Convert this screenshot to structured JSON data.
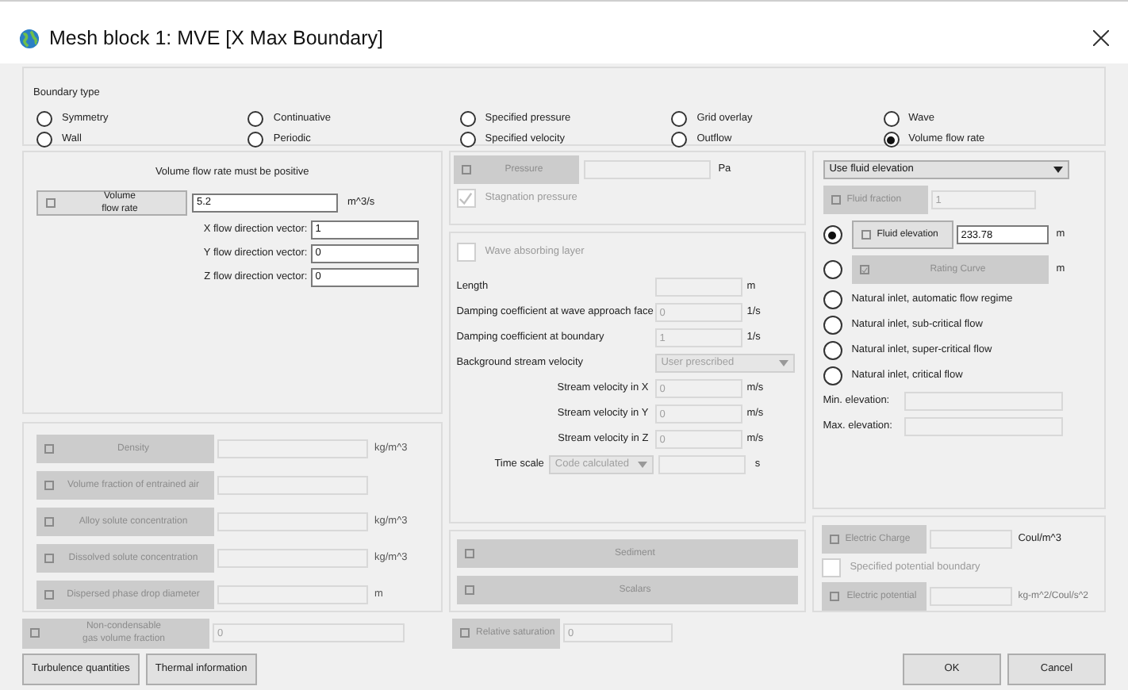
{
  "window": {
    "title": "Mesh block 1: MVE [X Max Boundary]"
  },
  "boundary_type": {
    "label": "Boundary type",
    "options": [
      {
        "label": "Symmetry",
        "selected": false
      },
      {
        "label": "Continuative",
        "selected": false
      },
      {
        "label": "Specified pressure",
        "selected": false
      },
      {
        "label": "Grid overlay",
        "selected": false
      },
      {
        "label": "Wave",
        "selected": false
      },
      {
        "label": "Wall",
        "selected": false
      },
      {
        "label": "Periodic",
        "selected": false
      },
      {
        "label": "Specified velocity",
        "selected": false
      },
      {
        "label": "Outflow",
        "selected": false
      },
      {
        "label": "Volume flow rate",
        "selected": true
      }
    ]
  },
  "flow_rate": {
    "message": "Volume flow rate must be positive",
    "toggle": {
      "label": "Volume\nflow rate",
      "checked": false,
      "disabled": false
    },
    "value": "5.2",
    "unit": "m^3/s",
    "vectors": [
      {
        "label": "X flow direction vector:",
        "value": "1"
      },
      {
        "label": "Y flow direction vector:",
        "value": "0"
      },
      {
        "label": "Z flow direction vector:",
        "value": "0"
      }
    ]
  },
  "properties": [
    {
      "label": "Density",
      "checked": false,
      "unit": "kg/m^3"
    },
    {
      "label": "Volume fraction of entrained air",
      "checked": false
    },
    {
      "label": "Alloy solute concentration",
      "checked": false,
      "unit": "kg/m^3"
    },
    {
      "label": "Dissolved solute concentration",
      "checked": false,
      "unit": "kg/m^3"
    },
    {
      "label": "Dispersed phase drop diameter",
      "checked": false,
      "unit": "m"
    }
  ],
  "pressure": {
    "label": "Pressure",
    "checked": false,
    "unit": "Pa"
  },
  "stagnation": {
    "label": "Stagnation pressure",
    "checked": true
  },
  "wave": {
    "label": "Wave absorbing layer",
    "checked": false,
    "fields": [
      {
        "label": "Length",
        "unit": "m"
      },
      {
        "label": "Damping coefficient at wave approach face",
        "value": "0",
        "unit": "1/s"
      },
      {
        "label": "Damping coefficient at boundary",
        "value": "1",
        "unit": "1/s"
      }
    ],
    "background": {
      "label": "Background stream velocity",
      "value": "User prescribed"
    },
    "stream": [
      {
        "label": "Stream velocity in X",
        "value": "0",
        "unit": "m/s"
      },
      {
        "label": "Stream velocity in Y",
        "value": "0",
        "unit": "m/s"
      },
      {
        "label": "Stream velocity in Z",
        "value": "0",
        "unit": "m/s"
      }
    ],
    "time_scale": {
      "label": "Time scale",
      "value": "Code calculated",
      "unit": "s"
    }
  },
  "transport": [
    {
      "label": "Sediment",
      "checked": false
    },
    {
      "label": "Scalars",
      "checked": false
    }
  ],
  "elevation": {
    "mode": "Use fluid elevation",
    "fluid_fraction": {
      "label": "Fluid fraction",
      "checked": false,
      "value": "1"
    },
    "options": [
      {
        "kind": "field",
        "label": "Fluid elevation",
        "checked": false,
        "disabled": false,
        "value": "233.78",
        "unit": "m",
        "selected": true
      },
      {
        "kind": "button",
        "label": "Rating Curve",
        "checked": true,
        "unit": "m",
        "selected": false
      },
      {
        "kind": "plain",
        "label": "Natural inlet, automatic flow regime",
        "selected": false
      },
      {
        "kind": "plain",
        "label": "Natural inlet, sub-critical flow",
        "selected": false
      },
      {
        "kind": "plain",
        "label": "Natural inlet, super-critical flow",
        "selected": false
      },
      {
        "kind": "plain",
        "label": "Natural inlet, critical flow",
        "selected": false
      }
    ],
    "limits": [
      {
        "label": "Min. elevation:"
      },
      {
        "label": "Max. elevation:"
      }
    ]
  },
  "electric": {
    "charge": {
      "label": "Electric Charge",
      "checked": false,
      "unit": "Coul/m^3"
    },
    "potential_boundary": {
      "label": "Specified potential boundary",
      "checked": false
    },
    "potential": {
      "label": "Electric potential",
      "checked": false,
      "unit": "kg-m^2/Coul/s^2"
    }
  },
  "noncondensable": {
    "label": "Non-condensable\ngas volume fraction",
    "checked": false,
    "value": "0"
  },
  "relative_saturation": {
    "label": "Relative saturation",
    "checked": false,
    "value": "0"
  },
  "left_buttons": [
    "Turbulence quantities",
    "Thermal information"
  ],
  "dialog_buttons": [
    "OK",
    "Cancel"
  ]
}
